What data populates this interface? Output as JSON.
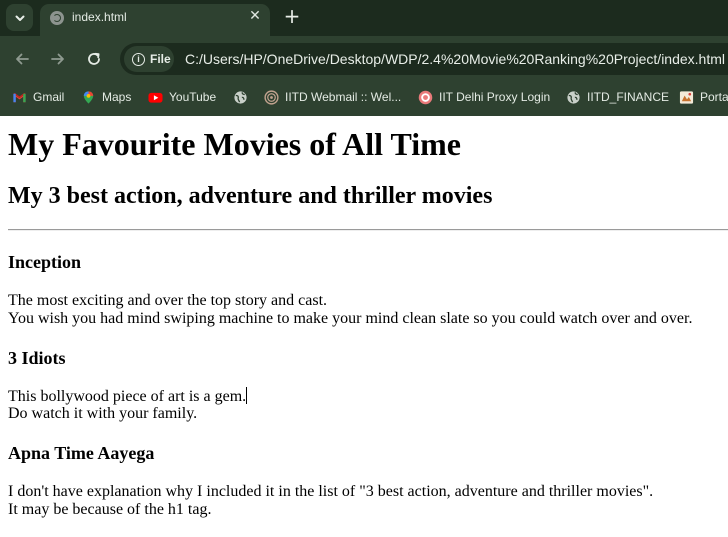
{
  "browser": {
    "tab": {
      "title": "index.html",
      "favicon": "globe-icon"
    },
    "address_bar": {
      "site_chip_label": "File",
      "url": "C:/Users/HP/OneDrive/Desktop/WDP/2.4%20Movie%20Ranking%20Project/index.html"
    },
    "bookmarks": [
      {
        "label": "Gmail",
        "icon": "gmail-icon"
      },
      {
        "label": "Maps",
        "icon": "maps-icon"
      },
      {
        "label": "YouTube",
        "icon": "youtube-icon"
      },
      {
        "label": "",
        "icon": "globe-icon"
      },
      {
        "label": "IITD Webmail :: Wel...",
        "icon": "iitd-icon"
      },
      {
        "label": "IIT Delhi Proxy Login",
        "icon": "iitd-proxy-icon"
      },
      {
        "label": "IITD_FINANCE",
        "icon": "globe-icon"
      },
      {
        "label": "Porta",
        "icon": "portal-icon"
      }
    ],
    "colors": {
      "chrome_dark": "#1c2b1e",
      "chrome": "#2e4130",
      "text": "#e4ebe4"
    }
  },
  "page": {
    "h1": "My Favourite Movies of All Time",
    "h2": "My 3 best action, adventure and thriller movies",
    "movies": [
      {
        "title": "Inception",
        "lines": [
          "The most exciting and over the top story and cast.",
          "You wish you had mind swiping machine to make your mind clean slate so you could watch over and over."
        ]
      },
      {
        "title": "3 Idiots",
        "lines": [
          "This bollywood piece of art is a gem.",
          "Do watch it with your family."
        ]
      },
      {
        "title": "Apna Time Aayega",
        "lines": [
          "I don't have explanation why I included it in the list of \"3 best action, adventure and thriller movies\".",
          "It may be because of the h1 tag."
        ]
      }
    ]
  }
}
